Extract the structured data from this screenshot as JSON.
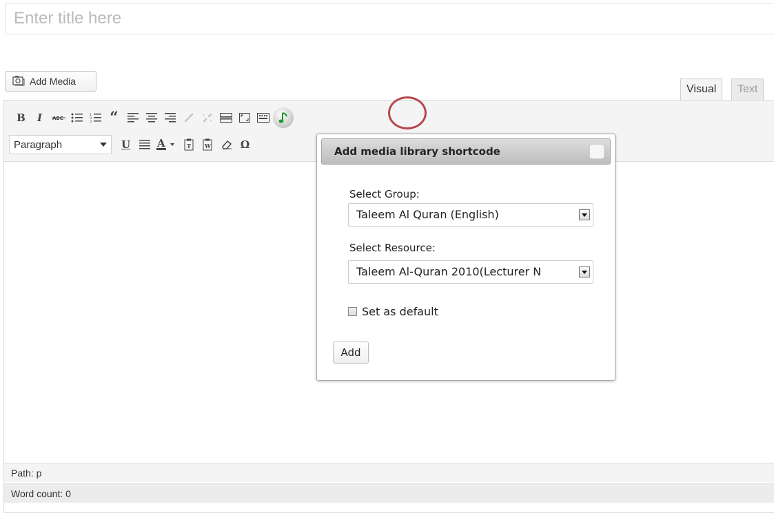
{
  "title_field": {
    "placeholder": "Enter title here"
  },
  "media": {
    "add_media_label": "Add Media"
  },
  "tabs": {
    "visual": "Visual",
    "text": "Text"
  },
  "toolbar": {
    "row1_icons": [
      "bold-icon",
      "italic-icon",
      "strikethrough-icon",
      "bullet-list-icon",
      "numbered-list-icon",
      "blockquote-icon",
      "align-left-icon",
      "align-center-icon",
      "align-right-icon",
      "link-icon",
      "unlink-icon",
      "insert-more-icon",
      "fullscreen-icon",
      "kitchen-sink-icon",
      "media-library-shortcode-icon"
    ],
    "format_select": "Paragraph",
    "row2_icons": [
      "underline-icon",
      "justify-icon",
      "text-color-icon",
      "paste-text-icon",
      "paste-word-icon",
      "clear-formatting-icon",
      "special-character-icon"
    ]
  },
  "popup": {
    "title": "Add media library shortcode",
    "group_label": "Select Group:",
    "group_value": "Taleem Al Quran (English)",
    "resource_label": "Select Resource:",
    "resource_value": "Taleem Al-Quran 2010(Lecturer N",
    "default_label": "Set as default",
    "default_checked": false,
    "add_label": "Add"
  },
  "status": {
    "path": "Path: p",
    "word_count": "Word count: 0"
  },
  "colors": {
    "highlight": "#b5474a",
    "toolbar_bg": "#f4f4f4"
  }
}
